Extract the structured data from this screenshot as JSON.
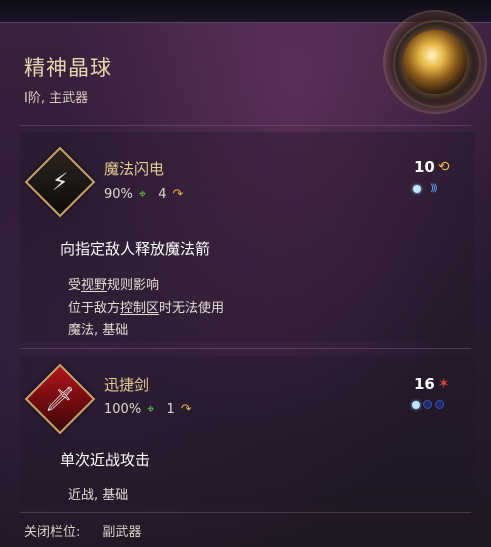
{
  "item": {
    "name": "精神晶球",
    "subtitle": "I阶, 主武器",
    "orb_icon": "glowing-golden-orb"
  },
  "skills": [
    {
      "name": "魔法闪电",
      "hit_chance": "90%",
      "hit_icon": "target-icon",
      "range": "4",
      "range_icon": "arc-arrow-icon",
      "cost": "10",
      "cost_icon": "focus-swirl-icon",
      "cooldown_pips": [
        "filled",
        "chevrons"
      ],
      "description": "向指定敌人释放魔法箭",
      "line1_pre": "受",
      "line1_link": "视野",
      "line1_post": "规则影响",
      "line2_pre": "位于敌方",
      "line2_link": "控制区",
      "line2_post": "时无法使用",
      "tags": "魔法, 基础",
      "icon": "magic-lightning-icon"
    },
    {
      "name": "迅捷剑",
      "hit_chance": "100%",
      "hit_icon": "target-icon",
      "range": "1",
      "range_icon": "arc-arrow-icon",
      "cost": "16",
      "cost_icon": "red-burst-icon",
      "cooldown_pips": [
        "filled",
        "empty",
        "empty"
      ],
      "description": "单次近战攻击",
      "tags": "近战, 基础",
      "icon": "sword-icon"
    }
  ],
  "footer": {
    "label": "关闭栏位:",
    "value": "副武器"
  },
  "colors": {
    "title_gold": "#e9d7b0",
    "skill_name": "#e6cc94",
    "pip_blue": "#5fa8ff",
    "hit_green": "#6fcf4a"
  }
}
